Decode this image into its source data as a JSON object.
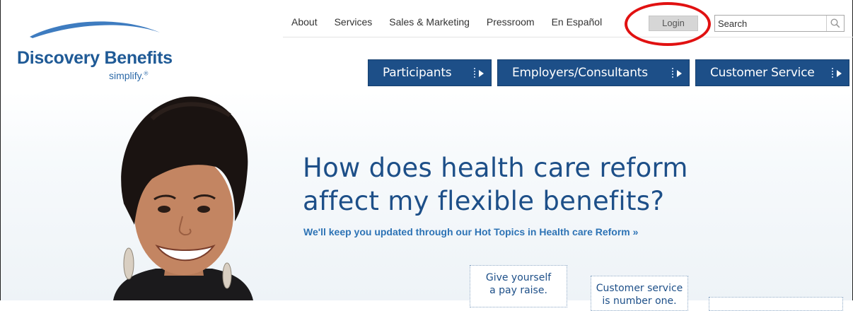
{
  "brand": {
    "name": "Discovery Benefits",
    "tagline": "simplify.",
    "trademark": "®"
  },
  "topnav": {
    "links": [
      "About",
      "Services",
      "Sales & Marketing",
      "Pressroom",
      "En Español"
    ],
    "login": "Login"
  },
  "search": {
    "placeholder": "Search"
  },
  "mainnav": [
    {
      "label": "Participants"
    },
    {
      "label": "Employers/Consultants"
    },
    {
      "label": "Customer Service"
    }
  ],
  "hero": {
    "headline_line1": "How does health care reform",
    "headline_line2": "affect my flexible benefits?",
    "link": "We'll keep you updated through our Hot Topics in Health care Reform »"
  },
  "promos": [
    {
      "line1": "Give yourself",
      "line2": "a pay raise."
    },
    {
      "line1": "Customer service",
      "line2": "is number one."
    }
  ],
  "colors": {
    "brand_blue": "#1d4f88",
    "link_blue": "#2d73b5",
    "annotation_red": "#e11111"
  }
}
